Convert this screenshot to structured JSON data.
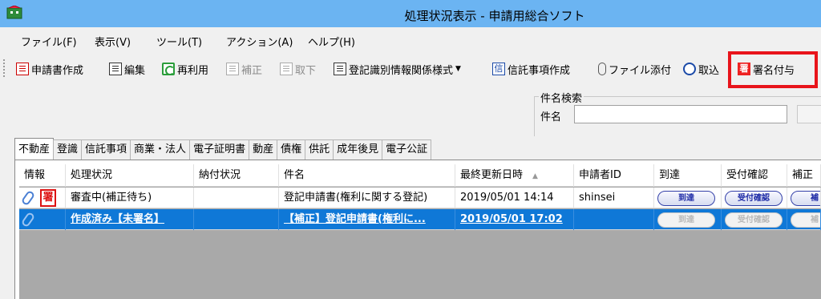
{
  "window": {
    "title": "処理状況表示 - 申請用総合ソフト"
  },
  "menu": [
    {
      "label": "ファイル(F)"
    },
    {
      "label": "表示(V)"
    },
    {
      "label": "ツール(T)"
    },
    {
      "label": "アクション(A)"
    },
    {
      "label": "ヘルプ(H)"
    }
  ],
  "toolbar": {
    "create": "申請書作成",
    "edit": "編集",
    "reuse": "再利用",
    "correct": "補正",
    "withdraw": "取下",
    "registration_form": "登記識別情報関係様式",
    "trust": "信託事項作成",
    "attach": "ファイル添付",
    "import": "取込",
    "sign": "署名付与",
    "trust_icon_char": "信",
    "sign_icon_char": "署"
  },
  "search": {
    "group_label": "件名検索",
    "field_label": "件名",
    "value": ""
  },
  "tabs": [
    "不動産",
    "登識",
    "信託事項",
    "商業・法人",
    "電子証明書",
    "動産",
    "債権",
    "供託",
    "成年後見",
    "電子公証"
  ],
  "active_tab": 0,
  "grid": {
    "columns": [
      "情報",
      "処理状況",
      "納付状況",
      "件名",
      "最終更新日時",
      "申請者ID",
      "到達",
      "受付確認",
      "補正"
    ],
    "sort_indicator": "▲",
    "rows": [
      {
        "info_badge": "署",
        "status": "審査中(補正待ち)",
        "payment": "",
        "subject": "登記申請書(権利に関する登記)",
        "updated": "2019/05/01 14:14",
        "applicant_id": "shinsei",
        "arrival": "到達",
        "receipt": "受付確認",
        "correction": "補",
        "selected": false
      },
      {
        "info_badge": "",
        "status": "作成済み【未署名】",
        "payment": "",
        "subject": "【補正】登記申請書(権利に...",
        "updated": "2019/05/01 17:02",
        "applicant_id": "",
        "arrival": "到達",
        "receipt": "受付確認",
        "correction": "補",
        "selected": true
      }
    ]
  },
  "colors": {
    "titlebar": "#6bb4f2",
    "selection": "#0f78d7",
    "highlight_box": "#e8141b"
  }
}
